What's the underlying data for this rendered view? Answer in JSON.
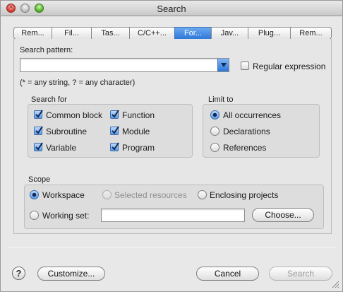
{
  "window": {
    "title": "Search"
  },
  "tabs": [
    {
      "label": "Rem..."
    },
    {
      "label": "Fil..."
    },
    {
      "label": "Tas..."
    },
    {
      "label": "C/C++..."
    },
    {
      "label": "For...",
      "active": true
    },
    {
      "label": "Jav..."
    },
    {
      "label": "Plug..."
    },
    {
      "label": "Rem..."
    }
  ],
  "search": {
    "pattern_label": "Search pattern:",
    "pattern_value": "",
    "regex_label": "Regular expression",
    "regex_checked": false,
    "hint": "(* = any string, ? = any character)"
  },
  "search_for": {
    "title": "Search for",
    "items": [
      {
        "label": "Common block",
        "checked": true
      },
      {
        "label": "Function",
        "checked": true
      },
      {
        "label": "Subroutine",
        "checked": true
      },
      {
        "label": "Module",
        "checked": true
      },
      {
        "label": "Variable",
        "checked": true
      },
      {
        "label": "Program",
        "checked": true
      }
    ]
  },
  "limit_to": {
    "title": "Limit to",
    "items": [
      {
        "label": "All occurrences",
        "selected": true
      },
      {
        "label": "Declarations",
        "selected": false
      },
      {
        "label": "References",
        "selected": false
      }
    ]
  },
  "scope": {
    "title": "Scope",
    "workspace": "Workspace",
    "selected_resources": "Selected resources",
    "enclosing_projects": "Enclosing projects",
    "working_set": "Working set:",
    "working_set_value": "",
    "choose": "Choose..."
  },
  "footer": {
    "help": "?",
    "customize": "Customize...",
    "cancel": "Cancel",
    "search": "Search"
  },
  "colors": {
    "accent": "#2f78d9",
    "window_bg": "#e8e8e8"
  }
}
